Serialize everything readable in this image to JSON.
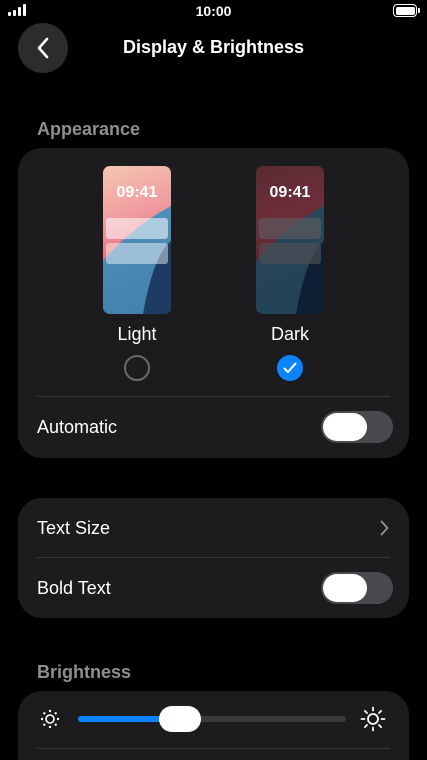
{
  "status_bar": {
    "time": "10:00",
    "signal_icon": "cellular-signal-icon",
    "battery_icon": "battery-full-icon"
  },
  "nav": {
    "title": "Display & Brightness",
    "back_icon": "chevron-left-icon"
  },
  "appearance": {
    "section_label": "Appearance",
    "preview_time": "09:41",
    "options": [
      {
        "label": "Light",
        "selected": false
      },
      {
        "label": "Dark",
        "selected": true
      }
    ],
    "automatic_label": "Automatic",
    "automatic_on": false
  },
  "text_settings": {
    "text_size_label": "Text Size",
    "bold_text_label": "Bold Text",
    "bold_text_on": false
  },
  "brightness": {
    "section_label": "Brightness",
    "level": 0.38
  },
  "colors": {
    "accent": "#0a84ff",
    "card": "#1c1c1e",
    "background": "#000000"
  }
}
